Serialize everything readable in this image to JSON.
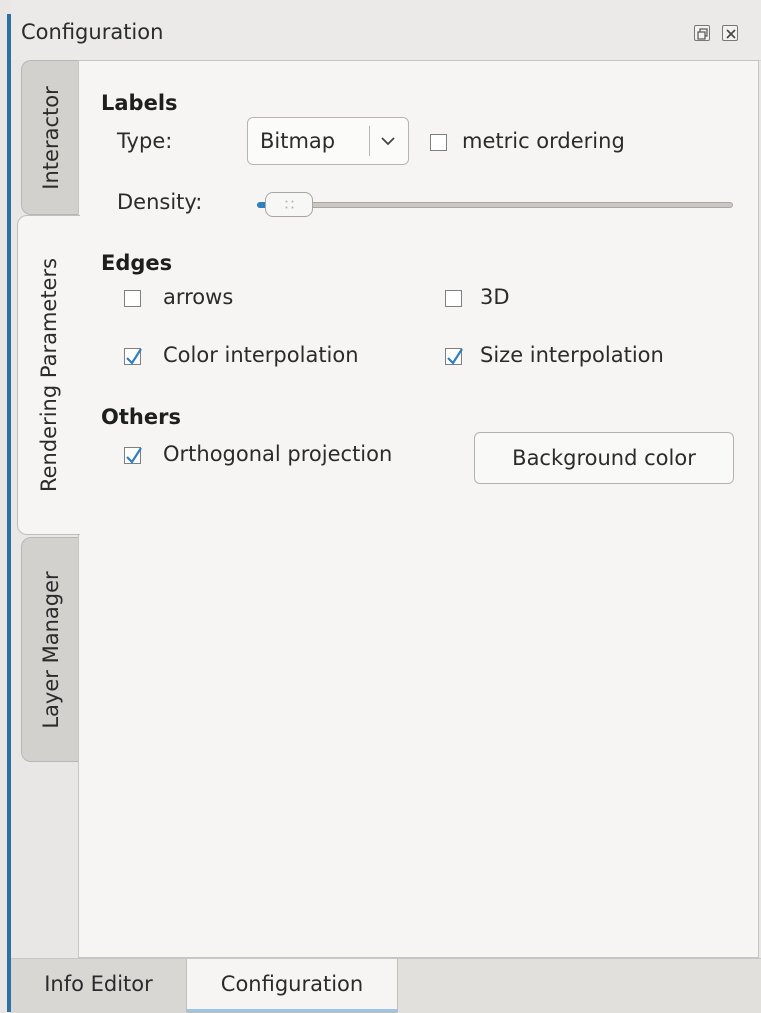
{
  "dock": {
    "title": "Configuration"
  },
  "vertical_tabs": {
    "interactor": "Interactor",
    "rendering": "Rendering Parameters",
    "layer": "Layer Manager"
  },
  "labels_section": {
    "title": "Labels",
    "type_label": "Type:",
    "type_value": "Bitmap",
    "metric_ordering": "metric ordering",
    "metric_ordering_checked": false,
    "density_label": "Density:",
    "density_level": 0.02
  },
  "edges_section": {
    "title": "Edges",
    "arrows": "arrows",
    "arrows_checked": false,
    "three_d": "3D",
    "three_d_checked": false,
    "color_interp": "Color interpolation",
    "color_interp_checked": true,
    "size_interp": "Size interpolation",
    "size_interp_checked": true
  },
  "others_section": {
    "title": "Others",
    "ortho": "Orthogonal projection",
    "ortho_checked": true,
    "bg_button": "Background color"
  },
  "bottom_tabs": {
    "info_editor": "Info Editor",
    "configuration": "Configuration"
  },
  "colors": {
    "accent": "#2f7fc1",
    "left_border": "#2f6fa1"
  }
}
